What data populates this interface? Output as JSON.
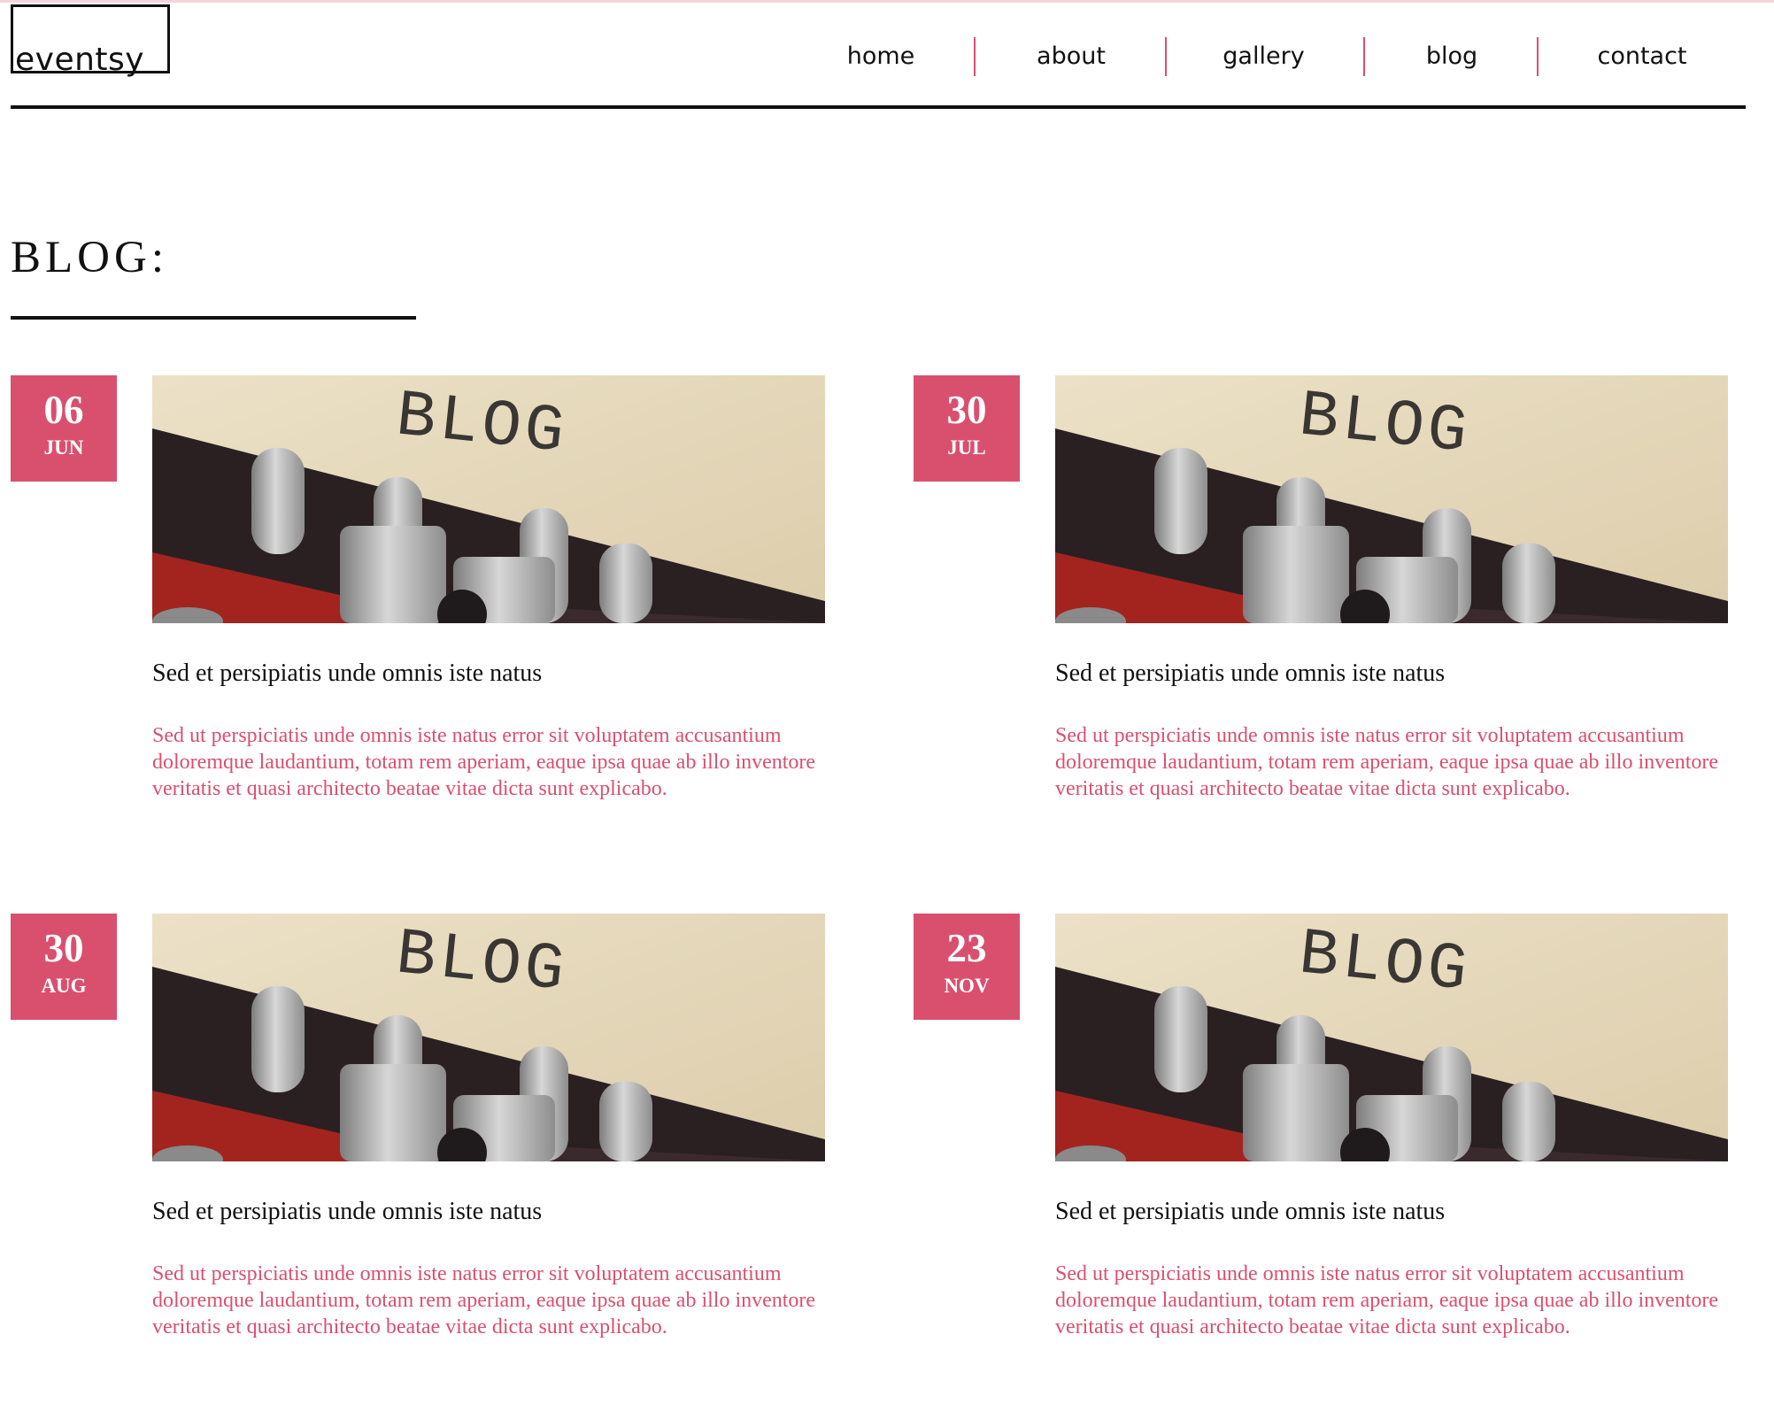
{
  "brand": {
    "name": "eventsy"
  },
  "nav": {
    "items": [
      {
        "label": "home"
      },
      {
        "label": "about"
      },
      {
        "label": "gallery"
      },
      {
        "label": "blog"
      },
      {
        "label": "contact"
      }
    ]
  },
  "page": {
    "title": "BLOG:"
  },
  "posts": [
    {
      "day": "06",
      "month": "JUN",
      "image_text": "BLOG",
      "title": "Sed et persipiatis unde omnis iste natus",
      "excerpt": "Sed ut perspiciatis unde omnis iste natus error sit voluptatem accusantium doloremque laudantium, totam rem aperiam, eaque ipsa quae ab illo inventore veritatis et quasi architecto beatae vitae dicta sunt explicabo."
    },
    {
      "day": "30",
      "month": "JUL",
      "image_text": "BLOG",
      "title": "Sed et persipiatis unde omnis iste natus",
      "excerpt": "Sed ut perspiciatis unde omnis iste natus error sit voluptatem accusantium doloremque laudantium, totam rem aperiam, eaque ipsa quae ab illo inventore veritatis et quasi architecto beatae vitae dicta sunt explicabo."
    },
    {
      "day": "30",
      "month": "AUG",
      "image_text": "BLOG",
      "title": "Sed et persipiatis unde omnis iste natus",
      "excerpt": "Sed ut perspiciatis unde omnis iste natus error sit voluptatem accusantium doloremque laudantium, totam rem aperiam, eaque ipsa quae ab illo inventore veritatis et quasi architecto beatae vitae dicta sunt explicabo."
    },
    {
      "day": "23",
      "month": "NOV",
      "image_text": "BLOG",
      "title": "Sed et persipiatis unde omnis iste natus",
      "excerpt": "Sed ut perspiciatis unde omnis iste natus error sit voluptatem accusantium doloremque laudantium, totam rem aperiam, eaque ipsa quae ab illo inventore veritatis et quasi architecto beatae vitae dicta sunt explicabo."
    }
  ],
  "colors": {
    "accent": "#d9506f",
    "text": "#111111",
    "background": "#ffffff"
  }
}
